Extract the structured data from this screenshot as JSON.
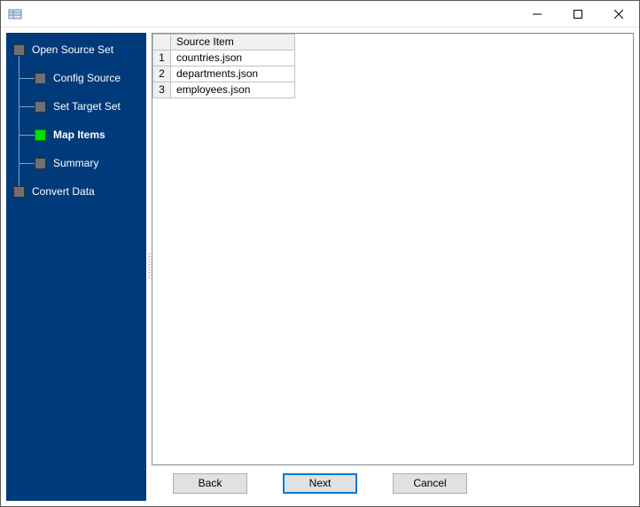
{
  "window": {
    "title": ""
  },
  "sidebar": {
    "items": [
      {
        "label": "Open Source Set",
        "level": 0,
        "active": false
      },
      {
        "label": "Config Source",
        "level": 1,
        "active": false
      },
      {
        "label": "Set Target Set",
        "level": 1,
        "active": false
      },
      {
        "label": "Map Items",
        "level": 1,
        "active": true
      },
      {
        "label": "Summary",
        "level": 1,
        "active": false
      },
      {
        "label": "Convert Data",
        "level": 0,
        "active": false
      }
    ]
  },
  "grid": {
    "header": {
      "source_item": "Source Item"
    },
    "rows": [
      {
        "n": "1",
        "source_item": "countries.json"
      },
      {
        "n": "2",
        "source_item": "departments.json"
      },
      {
        "n": "3",
        "source_item": "employees.json"
      }
    ]
  },
  "buttons": {
    "back": "Back",
    "next": "Next",
    "cancel": "Cancel"
  }
}
